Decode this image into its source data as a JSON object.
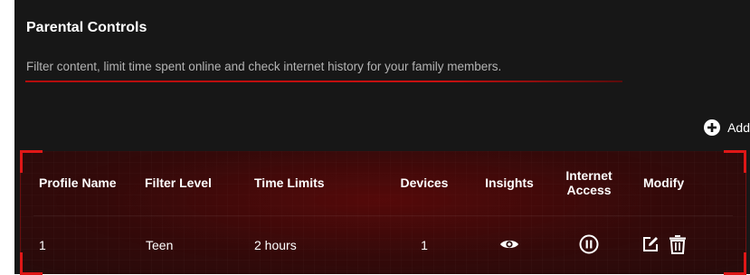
{
  "panel": {
    "title": "Parental Controls",
    "subtitle": "Filter content, limit time spent online and check internet history for your family members.",
    "accent_color": "#e01717"
  },
  "add_button": {
    "label": "Add",
    "icon": "plus-circle-icon"
  },
  "table": {
    "headers": {
      "profile_name": "Profile Name",
      "filter_level": "Filter Level",
      "time_limits": "Time Limits",
      "devices": "Devices",
      "insights": "Insights",
      "internet_access": "Internet Access",
      "modify": "Modify"
    },
    "rows": [
      {
        "profile_name": "1",
        "filter_level": "Teen",
        "time_limits": "2 hours",
        "devices": "1",
        "insights_icon": "eye-icon",
        "internet_access_icon": "pause-circle-icon",
        "modify_icons": [
          "edit-icon",
          "trash-icon"
        ]
      }
    ]
  }
}
